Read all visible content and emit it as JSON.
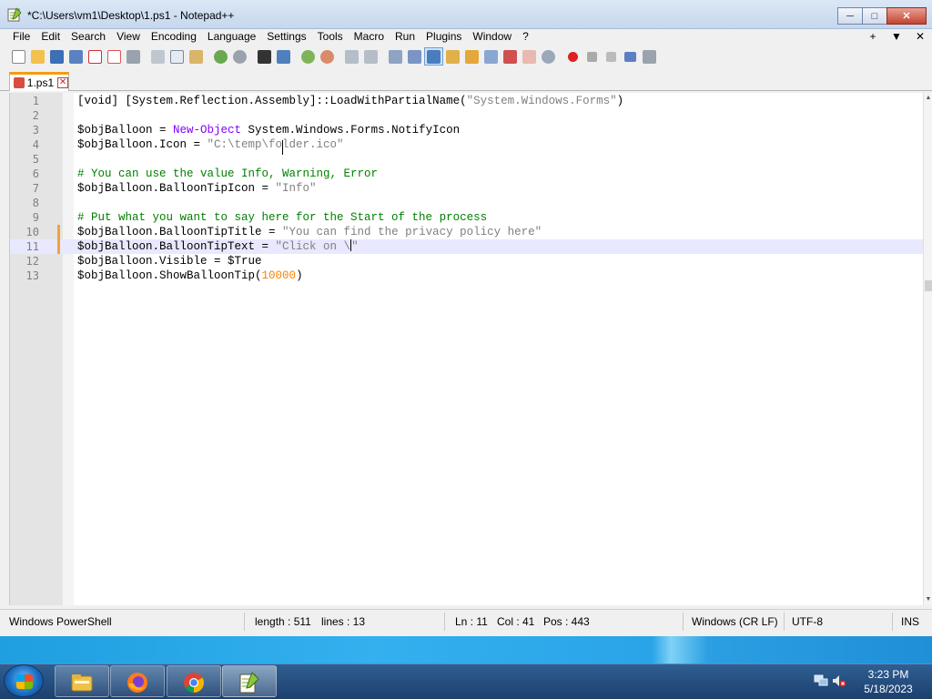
{
  "window": {
    "title": "*C:\\Users\\vm1\\Desktop\\1.ps1 - Notepad++"
  },
  "menu": {
    "items": [
      "File",
      "Edit",
      "Search",
      "View",
      "Encoding",
      "Language",
      "Settings",
      "Tools",
      "Macro",
      "Run",
      "Plugins",
      "Window",
      "?"
    ],
    "right": [
      "+",
      "▼",
      "✕"
    ]
  },
  "tab": {
    "label": "1.ps1"
  },
  "code": {
    "line_numbers": [
      "1",
      "2",
      "3",
      "4",
      "5",
      "6",
      "7",
      "8",
      "9",
      "10",
      "11",
      "12",
      "13"
    ],
    "l1a": "[void] [System.Reflection.Assembly]::LoadWithPartialName(",
    "l1b": "\"System.Windows.Forms\"",
    "l1c": ")",
    "l3a": "$objBalloon = ",
    "l3b": "New-Object",
    "l3c": " System.Windows.Forms.NotifyIcon",
    "l4a": "$objBalloon.Icon = ",
    "l4b": "\"C:\\temp\\folder.ico\"",
    "l6": "# You can use the value Info, Warning, Error",
    "l7a": "$objBalloon.BalloonTipIcon = ",
    "l7b": "\"Info\"",
    "l9": "# Put what you want to say here for the Start of the process",
    "l10a": "$objBalloon.BalloonTipTitle = ",
    "l10b": "\"You can find the privacy policy here\"",
    "l11a": "$objBalloon.BalloonTipText = ",
    "l11b": "\"Click on \\",
    "l11c": "\"",
    "l12": "$objBalloon.Visible = $True",
    "l13a": "$objBalloon.ShowBalloonTip(",
    "l13b": "10000",
    "l13c": ")"
  },
  "status": {
    "language": "Windows PowerShell",
    "length": "length : 511",
    "lines": "lines : 13",
    "ln": "Ln : 11",
    "col": "Col : 41",
    "pos": "Pos : 443",
    "eol": "Windows (CR LF)",
    "encoding": "UTF-8",
    "mode": "INS"
  },
  "taskbar": {
    "time": "3:23 PM",
    "date": "5/18/2023"
  },
  "colors": {
    "string": "#808080",
    "comment": "#008000",
    "cmdlet": "#8000ff",
    "number": "#ff8000",
    "modified": "#f3a13b"
  },
  "icons": [
    "notepad-plus-plus-icon",
    "start-orb-icon",
    "file-explorer-icon",
    "firefox-icon",
    "chrome-icon",
    "network-icon",
    "volume-muted-icon"
  ]
}
